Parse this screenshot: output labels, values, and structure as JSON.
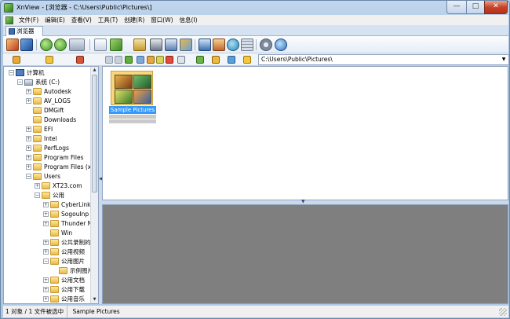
{
  "window": {
    "title": "XnView - [浏览器 - C:\\Users\\Public\\Pictures\\]",
    "min": "—",
    "max": "□",
    "close": "✕"
  },
  "menu": [
    "文件(F)",
    "编辑(E)",
    "查看(V)",
    "工具(T)",
    "创建(R)",
    "窗口(W)",
    "信息(I)"
  ],
  "tab": {
    "label": "浏览器"
  },
  "address": {
    "value": "C:\\Users\\Public\\Pictures\\"
  },
  "tree": [
    {
      "label": "计算机",
      "indent": 0,
      "kind": "pc",
      "exp": "−"
    },
    {
      "label": "系统 (C:)",
      "indent": 1,
      "kind": "drive",
      "exp": "−"
    },
    {
      "label": "Autodesk",
      "indent": 2,
      "kind": "folder",
      "exp": "+"
    },
    {
      "label": "AV_LOGS",
      "indent": 2,
      "kind": "folder",
      "exp": "+"
    },
    {
      "label": "DMGift",
      "indent": 2,
      "kind": "folder",
      "exp": ""
    },
    {
      "label": "Downloads",
      "indent": 2,
      "kind": "folder",
      "exp": ""
    },
    {
      "label": "EFI",
      "indent": 2,
      "kind": "folder",
      "exp": "+"
    },
    {
      "label": "Intel",
      "indent": 2,
      "kind": "folder",
      "exp": "+"
    },
    {
      "label": "PerfLogs",
      "indent": 2,
      "kind": "folder",
      "exp": "+"
    },
    {
      "label": "Program Files",
      "indent": 2,
      "kind": "folder",
      "exp": "+"
    },
    {
      "label": "Program Files (x",
      "indent": 2,
      "kind": "folder",
      "exp": "+"
    },
    {
      "label": "Users",
      "indent": 2,
      "kind": "folder",
      "exp": "−"
    },
    {
      "label": "XT23.com",
      "indent": 3,
      "kind": "folder",
      "exp": "+"
    },
    {
      "label": "公用",
      "indent": 3,
      "kind": "folder",
      "exp": "−"
    },
    {
      "label": "CyberLink",
      "indent": 4,
      "kind": "folder",
      "exp": "+"
    },
    {
      "label": "SogouInp",
      "indent": 4,
      "kind": "folder",
      "exp": "+"
    },
    {
      "label": "Thunder N",
      "indent": 4,
      "kind": "folder",
      "exp": "+"
    },
    {
      "label": "Win",
      "indent": 4,
      "kind": "folder",
      "exp": ""
    },
    {
      "label": "公共录制的",
      "indent": 4,
      "kind": "folder",
      "exp": "+"
    },
    {
      "label": "公用视频",
      "indent": 4,
      "kind": "folder",
      "exp": "+"
    },
    {
      "label": "公用图片",
      "indent": 4,
      "kind": "folder",
      "exp": "−"
    },
    {
      "label": "示例图片",
      "indent": 5,
      "kind": "folder",
      "exp": ""
    },
    {
      "label": "公用文档",
      "indent": 4,
      "kind": "folder",
      "exp": "+"
    },
    {
      "label": "公用下载",
      "indent": 4,
      "kind": "folder",
      "exp": "+"
    },
    {
      "label": "公用音乐",
      "indent": 4,
      "kind": "folder",
      "exp": "+"
    }
  ],
  "thumbnail": {
    "label": "Sample Pictures"
  },
  "status": {
    "count": "1 对象 / 1 文件被选中",
    "name": "Sample Pictures"
  }
}
